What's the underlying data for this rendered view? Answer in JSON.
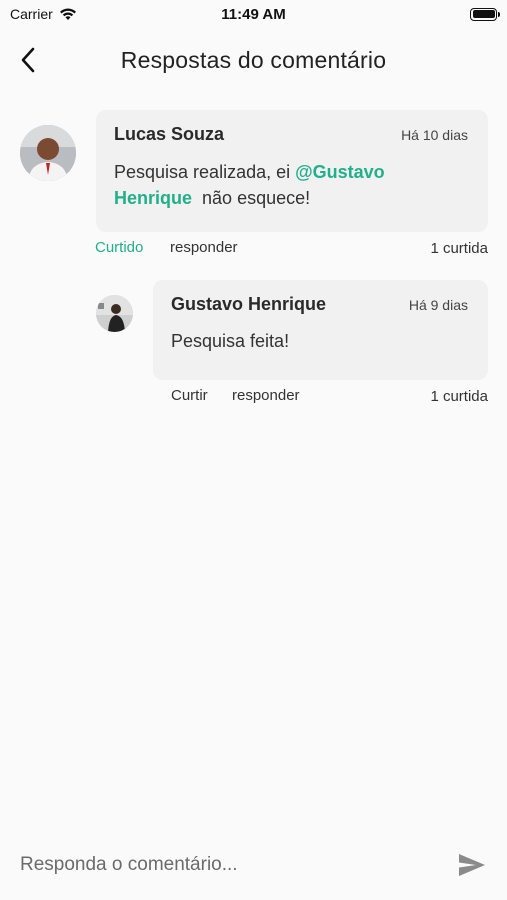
{
  "status_bar": {
    "carrier": "Carrier",
    "time": "11:49 AM"
  },
  "header": {
    "title": "Respostas do comentário",
    "back_icon": "chevron-left-icon"
  },
  "comment": {
    "author": "Lucas Souza",
    "time": "Há 10 dias",
    "text_before": "Pesquisa realizada, ei ",
    "mention_line1": "@Gustavo",
    "mention_line2": "Henrique",
    "text_after": "não esquece!",
    "like_label": "Curtido",
    "reply_label": "responder",
    "likes": "1 curtida"
  },
  "reply": {
    "author": "Gustavo Henrique",
    "time": "Há 9 dias",
    "text": "Pesquisa feita!",
    "like_label": "Curtir",
    "reply_label": "responder",
    "likes": "1 curtida"
  },
  "composer": {
    "placeholder": "Responda o comentário...",
    "send_icon": "send-icon"
  },
  "colors": {
    "accent": "#21b08a",
    "background": "#fafafa",
    "card": "#f1f1f1"
  }
}
